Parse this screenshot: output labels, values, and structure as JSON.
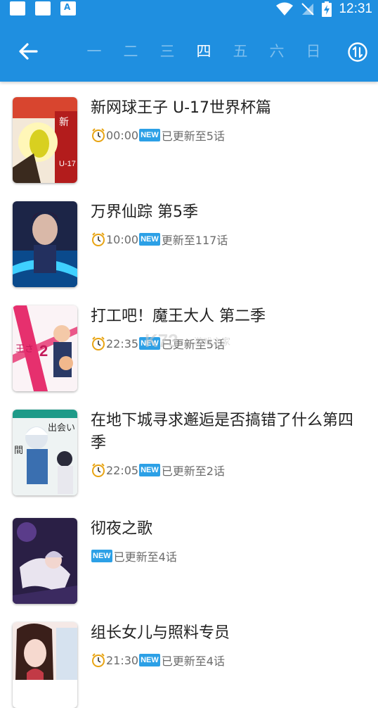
{
  "status_bar": {
    "time": "12:31"
  },
  "header": {
    "days": [
      "一",
      "二",
      "三",
      "四",
      "五",
      "六",
      "日"
    ],
    "active_day": "四"
  },
  "items": [
    {
      "title": "新网球王子 U-17世界杯篇",
      "time": "00:00",
      "update": "已更新至5话",
      "cover_text": "新\nU-17 W"
    },
    {
      "title": "万界仙踪 第5季",
      "time": "10:00",
      "update": "更新至117话"
    },
    {
      "title": "打工吧！魔王大人 第二季",
      "time": "22:35",
      "update": "已更新至5话",
      "cover_text": "王さ 2"
    },
    {
      "title": "在地下城寻求邂逅是否搞错了什么第四季",
      "time": "22:05",
      "update": "已更新至2话",
      "cover_text": "出会い 間 い"
    },
    {
      "title": "彻夜之歌",
      "time": "",
      "update": "已更新至4话"
    },
    {
      "title": "组长女儿与照料专员",
      "time": "21:30",
      "update": "已更新至4话"
    }
  ],
  "badge_text": "NEW",
  "watermark": "游戏之家",
  "colors": {
    "accent": "#1f8fe0",
    "new_badge": "#2ca0e6"
  }
}
